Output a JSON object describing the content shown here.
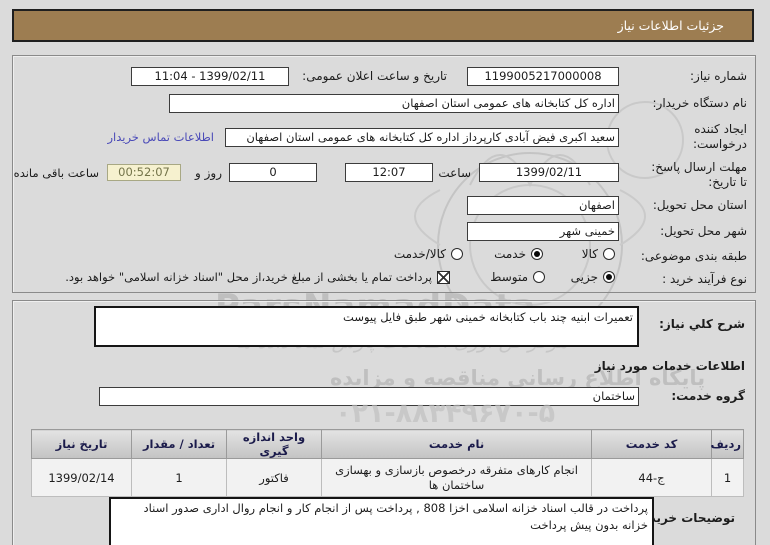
{
  "page": {
    "title": "جزئیات اطلاعات نیاز"
  },
  "details": {
    "need_number_label": "شماره نیاز:",
    "need_number": "1199005217000008",
    "announce_label": "تاریخ و ساعت اعلان عمومی:",
    "announce_value": "1399/02/11 - 11:04",
    "buyer_org_label": "نام دستگاه خریدار:",
    "buyer_org": "اداره کل کتابخانه های عمومی استان اصفهان",
    "creator_label": "ایجاد کننده درخواست:",
    "creator": "سعید اکبری فیض آبادی کارپرداز اداره کل کتابخانه های عمومی استان اصفهان",
    "contact_link": "اطلاعات تماس خریدار",
    "deadline_label1": "مهلت ارسال پاسخ:",
    "deadline_label2": "تا تاریخ:",
    "deadline_date": "1399/02/11",
    "hour_label": "ساعت",
    "deadline_time": "12:07",
    "days_value": "0",
    "days_label": "روز و",
    "countdown": "00:52:07",
    "remaining_label": "ساعت باقی مانده",
    "province_label": "استان محل تحویل:",
    "province": "اصفهان",
    "city_label": "شهر محل تحویل:",
    "city": "خمینی شهر",
    "category": {
      "label": "طبقه بندی موضوعی:",
      "options": [
        {
          "label": "کالا",
          "selected": false
        },
        {
          "label": "خدمت",
          "selected": true
        },
        {
          "label": "کالا/خدمت",
          "selected": false
        }
      ]
    },
    "process": {
      "label": "نوع فرآیند خرید :",
      "options": [
        {
          "label": "جزیی",
          "selected": true
        },
        {
          "label": "متوسط",
          "selected": false
        }
      ]
    },
    "treasury_note": "پرداخت تمام یا بخشی از مبلغ خرید،از محل \"اسناد خزانه اسلامی\" خواهد بود."
  },
  "need_desc": {
    "label": "شرح کلي نیاز:",
    "text": "تعمیرات ابنیه چند باب کتابخانه خمینی شهر طبق فایل پیوست"
  },
  "services": {
    "section_title": "اطلاعات خدمات مورد نیاز",
    "group_label": "گروه خدمت:",
    "group_value": "ساختمان",
    "table": {
      "headers": [
        "ردیف",
        "کد خدمت",
        "نام خدمت",
        "واحد اندازه گیری",
        "تعداد / مقدار",
        "تاریخ نیاز"
      ],
      "rows": [
        [
          "1",
          "ج-44",
          "انجام کارهای متفرقه درخصوص بازسازی و بهسازی ساختمان ها",
          "فاکتور",
          "1",
          "1399/02/14"
        ]
      ]
    }
  },
  "buyer_notes": {
    "label": "توضیحات خریدار:",
    "text": "پرداخت در قالب اسناد خزانه اسلامی اخزا 808 , پرداخت پس از انجام کار و انجام روال اداری صدور اسناد خزانه بدون پیش پرداخت"
  },
  "watermark": {
    "brand": "ParsNamadData",
    "line1": "مرکز فن آوری اطلاعات پارس نماد داده ها",
    "line2": "پایگاه اطلاع رسانی مناقصه و مزایده",
    "phone": "۰۲۱-۸۸۳۴۹۶۷۰-۵"
  },
  "colors": {
    "title_bg": "#9d7d51",
    "page_bg": "#dbdbdb",
    "link": "#4a4ab8",
    "countdown_bg": "#f6f1cf",
    "header_text": "#1b1b4b"
  }
}
